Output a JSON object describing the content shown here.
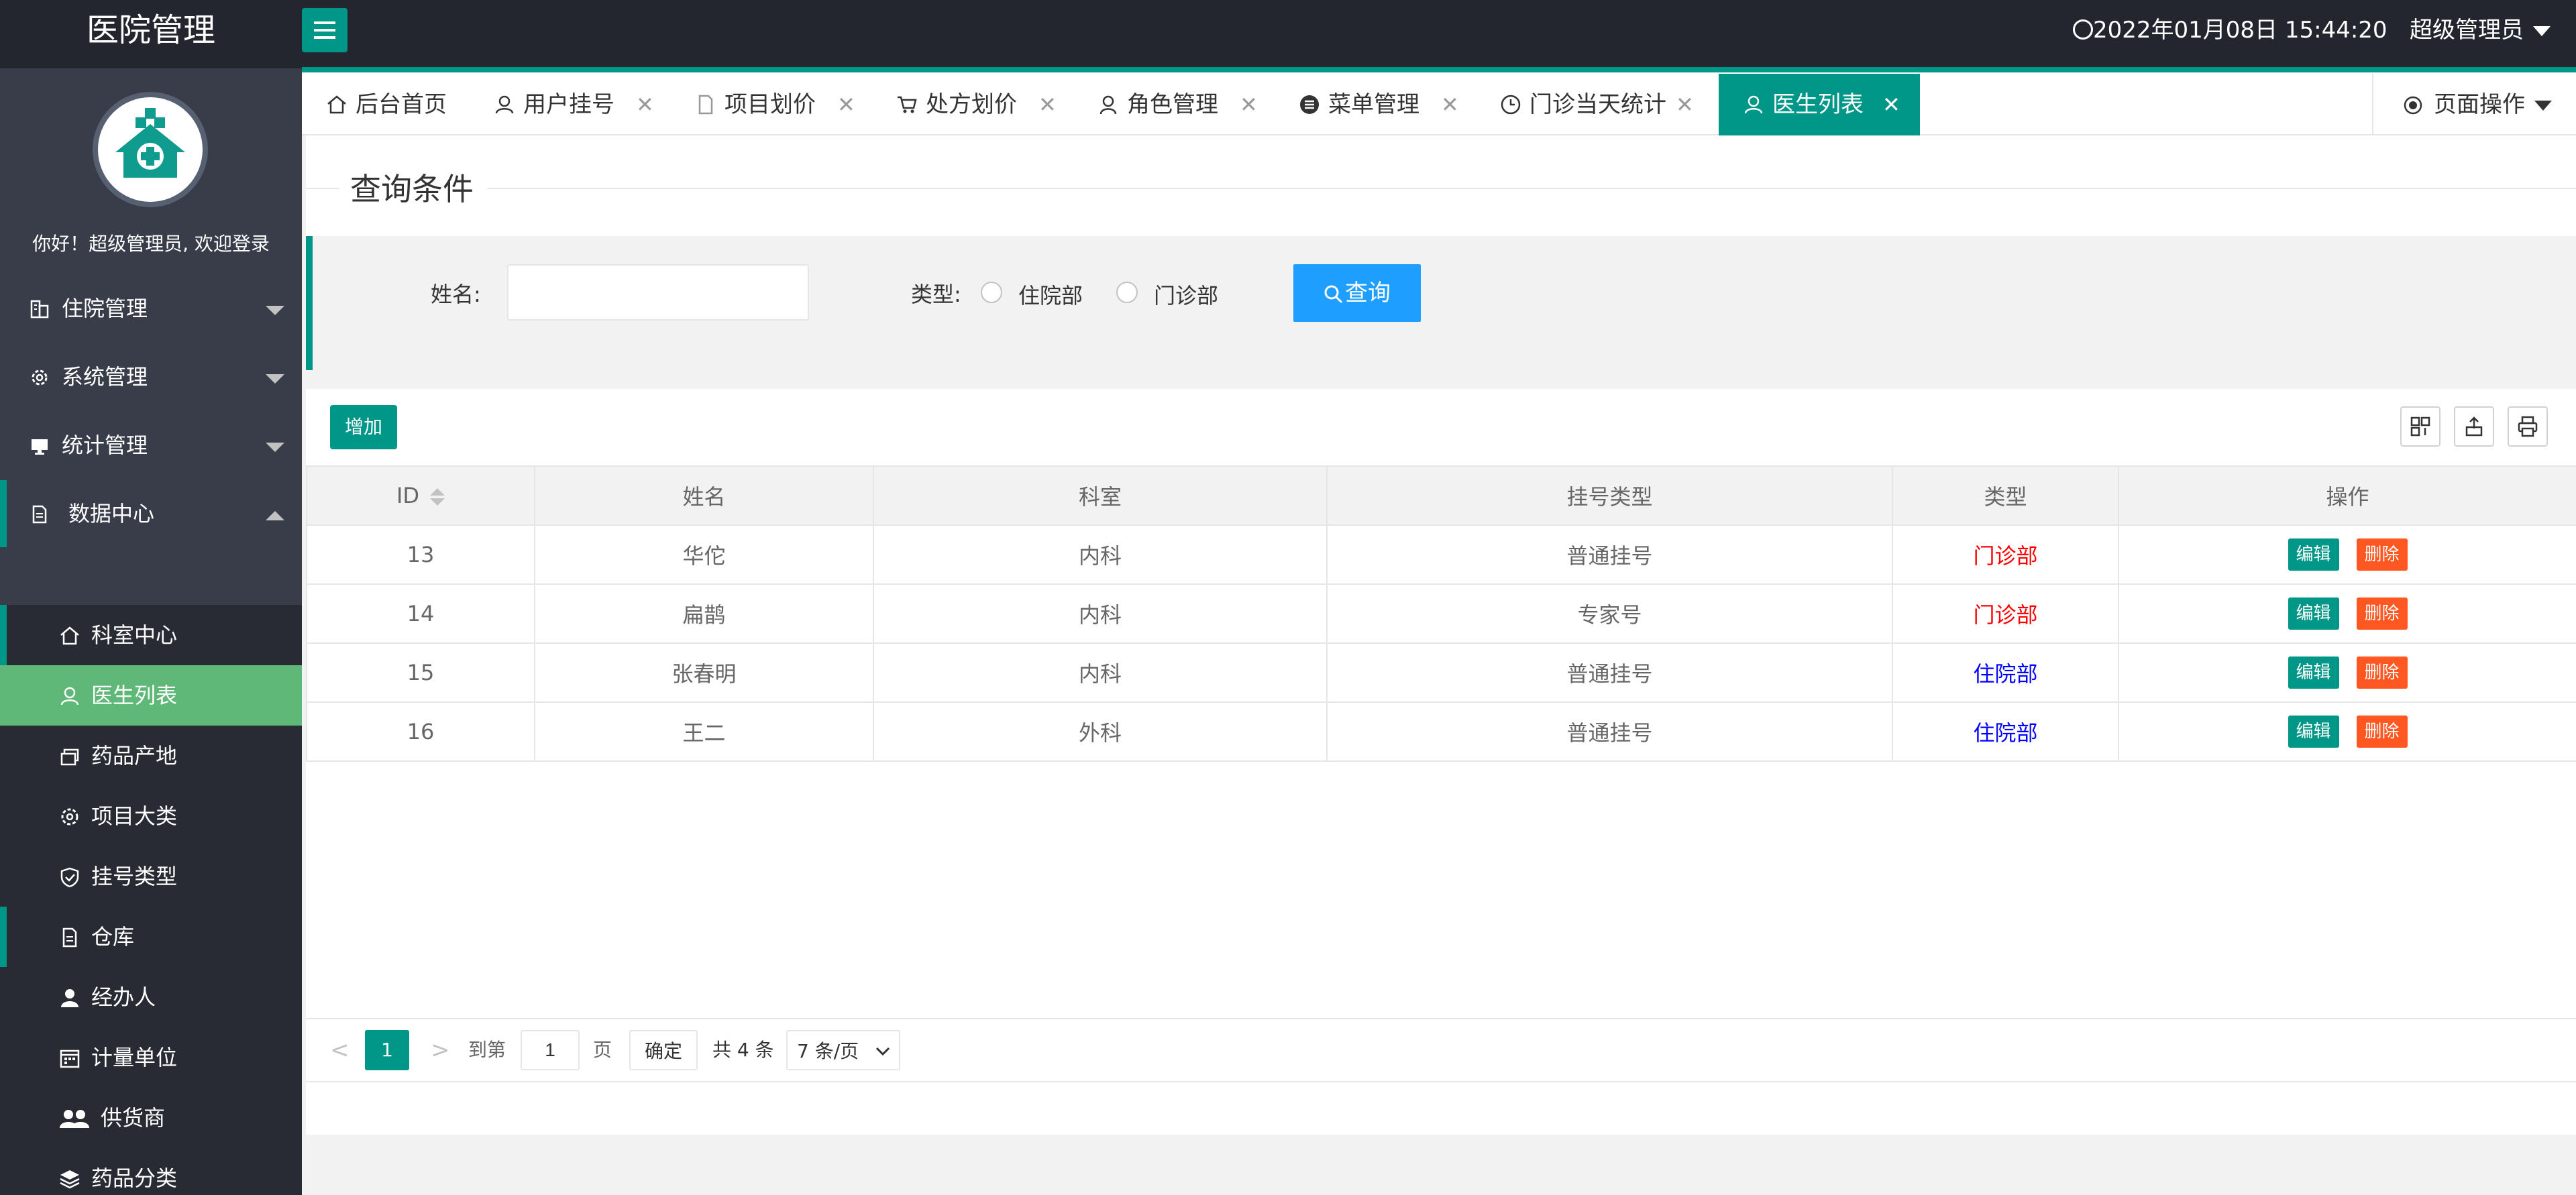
{
  "app": {
    "title": "医院管理",
    "datetime": "2022年01月08日 15:44:20",
    "user": "超级管理员"
  },
  "sidebar": {
    "welcome": "你好！超级管理员, 欢迎登录",
    "menus": [
      {
        "label": "住院管理",
        "icon": "building-icon"
      },
      {
        "label": "系统管理",
        "icon": "gear-icon"
      },
      {
        "label": "统计管理",
        "icon": "monitor-icon"
      },
      {
        "label": "数据中心",
        "icon": "document-icon"
      }
    ],
    "sub_items": [
      {
        "label": "科室中心",
        "icon": "home-icon"
      },
      {
        "label": "医生列表",
        "icon": "user-icon"
      },
      {
        "label": "药品产地",
        "icon": "stack-icon"
      },
      {
        "label": "项目大类",
        "icon": "gear-icon"
      },
      {
        "label": "挂号类型",
        "icon": "shield-icon"
      },
      {
        "label": "仓库",
        "icon": "document-icon"
      },
      {
        "label": "经办人",
        "icon": "person-icon"
      },
      {
        "label": "计量单位",
        "icon": "calendar-icon"
      },
      {
        "label": "供货商",
        "icon": "group-icon"
      },
      {
        "label": "药品分类",
        "icon": "layers-icon"
      }
    ]
  },
  "tabs": [
    {
      "label": "后台首页",
      "icon": "home-icon",
      "closable": false
    },
    {
      "label": "用户挂号",
      "icon": "user-icon",
      "closable": true
    },
    {
      "label": "项目划价",
      "icon": "document-icon",
      "closable": true
    },
    {
      "label": "处方划价",
      "icon": "cart-icon",
      "closable": true
    },
    {
      "label": "角色管理",
      "icon": "person-icon",
      "closable": true
    },
    {
      "label": "菜单管理",
      "icon": "menu-icon",
      "closable": true
    },
    {
      "label": "门诊当天统计",
      "icon": "clock-icon",
      "closable": true
    },
    {
      "label": "医生列表",
      "icon": "user-icon",
      "closable": true,
      "active": true
    }
  ],
  "page_op": "页面操作",
  "query": {
    "legend": "查询条件",
    "name_label": "姓名:",
    "name_value": "",
    "type_label": "类型:",
    "radio_zy": "住院部",
    "radio_mz": "门诊部",
    "search_button": "查询"
  },
  "toolbar": {
    "add_button": "增加"
  },
  "table": {
    "headers": [
      "ID",
      "姓名",
      "科室",
      "挂号类型",
      "类型",
      "操作"
    ],
    "rows": [
      {
        "id": "13",
        "name": "华佗",
        "dept": "内科",
        "reg_type": "普通挂号",
        "type": "门诊部"
      },
      {
        "id": "14",
        "name": "扁鹊",
        "dept": "内科",
        "reg_type": "专家号",
        "type": "门诊部"
      },
      {
        "id": "15",
        "name": "张春明",
        "dept": "内科",
        "reg_type": "普通挂号",
        "type": "住院部"
      },
      {
        "id": "16",
        "name": "王二",
        "dept": "外科",
        "reg_type": "普通挂号",
        "type": "住院部"
      }
    ],
    "edit_label": "编辑",
    "delete_label": "删除"
  },
  "pager": {
    "current": "1",
    "goto_label": "到第",
    "goto_value": "1",
    "page_suffix": "页",
    "confirm": "确定",
    "total": "共 4 条",
    "page_size": "7 条/页"
  },
  "colors": {
    "primary": "#009688",
    "sidebar": "#393d49",
    "active_menu": "#5fb878",
    "search": "#1e9fff",
    "danger": "#ff5722"
  }
}
